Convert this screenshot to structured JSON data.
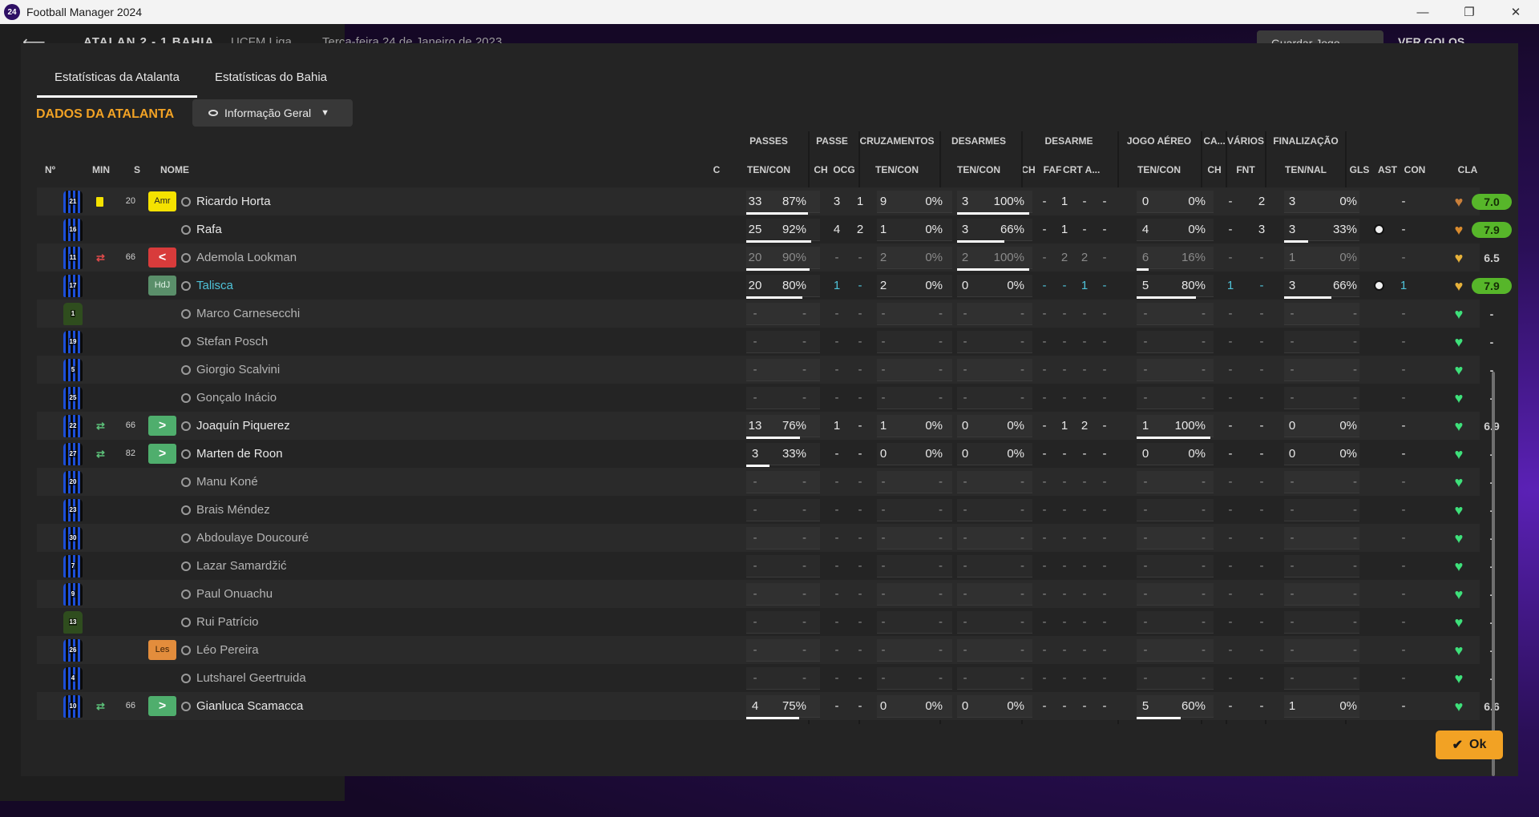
{
  "window": {
    "title": "Football Manager 2024",
    "logo": "24"
  },
  "behind": {
    "score": "ATALAN  2 - 1  BAHIA",
    "competition": "UCFM Liga",
    "date": "Terça-feira 24 de Janeiro de 2023",
    "save_label": "Guardar Jogo",
    "goals_label": "VER GOLOS"
  },
  "tabs": [
    "Estatísticas da Atalanta",
    "Estatísticas do Bahia"
  ],
  "section_title": "DADOS DA ATALANTA",
  "view_select": "Informação Geral",
  "groups": [
    "PASSES",
    "PASSE",
    "CRUZAMENTOS",
    "DESARMES",
    "DESARME",
    "JOGO AÉREO",
    "CA...",
    "VÁRIOS",
    "FINALIZAÇÃO"
  ],
  "columns": {
    "no": "Nº",
    "min": "MIN",
    "s": "S",
    "name": "NOME",
    "c": "C",
    "sub": [
      "TEN/CON",
      "CH",
      "OCG",
      "TEN/CON",
      "TEN/CON",
      "CH",
      "FAF",
      "CRT",
      "A...",
      "TEN/CON",
      "CH",
      "FNT",
      "TEN/NAL",
      "GLS",
      "AST",
      "CON",
      "CLA"
    ]
  },
  "players": [
    {
      "no": "21",
      "gk": false,
      "card": "yellow",
      "sub": "",
      "min": "20",
      "badge": "Amr",
      "badgeType": "amr",
      "name": "Ricardo Horta",
      "state": "active",
      "pass": [
        "33",
        "87%"
      ],
      "passBar": 0.87,
      "ch": "3",
      "ocg": "1",
      "cross": [
        "9",
        "0%"
      ],
      "crossBar": 0,
      "tackle": [
        "3",
        "100%"
      ],
      "tackleBar": 1,
      "d": [
        "-",
        "1",
        "-",
        "-"
      ],
      "air": [
        "0",
        "0%"
      ],
      "airBar": 0,
      "ca": "-",
      "fnt": "2",
      "fin": [
        "3",
        "0%"
      ],
      "finBar": 0,
      "gls": "",
      "ast": "-",
      "con": "#c97f3a",
      "cla": "7.0",
      "claGreen": true
    },
    {
      "no": "16",
      "gk": false,
      "card": "",
      "sub": "",
      "min": "",
      "badge": "",
      "badgeType": "",
      "name": "Rafa",
      "state": "active",
      "pass": [
        "25",
        "92%"
      ],
      "passBar": 0.92,
      "ch": "4",
      "ocg": "2",
      "cross": [
        "1",
        "0%"
      ],
      "crossBar": 0,
      "tackle": [
        "3",
        "66%"
      ],
      "tackleBar": 0.66,
      "d": [
        "-",
        "1",
        "-",
        "-"
      ],
      "air": [
        "4",
        "0%"
      ],
      "airBar": 0,
      "ca": "-",
      "fnt": "3",
      "fin": [
        "3",
        "33%"
      ],
      "finBar": 0.33,
      "gls": "ball",
      "ast": "-",
      "con": "#d98b2e",
      "cla": "7.9",
      "claGreen": true
    },
    {
      "no": "11",
      "gk": false,
      "card": "",
      "sub": "out",
      "min": "66",
      "badge": "<",
      "badgeType": "out",
      "name": "Ademola Lookman",
      "state": "inactive",
      "pass": [
        "20",
        "90%"
      ],
      "passBar": 0.9,
      "ch": "-",
      "ocg": "-",
      "cross": [
        "2",
        "0%"
      ],
      "crossBar": 0,
      "tackle": [
        "2",
        "100%"
      ],
      "tackleBar": 1,
      "d": [
        "-",
        "2",
        "2",
        "-"
      ],
      "air": [
        "6",
        "16%"
      ],
      "airBar": 0.16,
      "ca": "-",
      "fnt": "-",
      "fin": [
        "1",
        "0%"
      ],
      "finBar": 0,
      "gls": "",
      "ast": "-",
      "con": "#e6b13a",
      "cla": "6.5",
      "claGreen": false
    },
    {
      "no": "17",
      "gk": false,
      "card": "",
      "sub": "",
      "min": "",
      "badge": "HdJ",
      "badgeType": "hdj",
      "name": "Talisca",
      "state": "hl",
      "pass": [
        "20",
        "80%"
      ],
      "passBar": 0.8,
      "ch": "1",
      "ocg": "-",
      "cross": [
        "2",
        "0%"
      ],
      "crossBar": 0,
      "tackle": [
        "0",
        "0%"
      ],
      "tackleBar": 0,
      "d": [
        "-",
        "-",
        "1",
        "-"
      ],
      "air": [
        "5",
        "80%"
      ],
      "airBar": 0.8,
      "ca": "1",
      "fnt": "-",
      "fin": [
        "3",
        "66%"
      ],
      "finBar": 0.66,
      "gls": "ball",
      "ast": "1",
      "con": "#e6b13a",
      "cla": "7.9",
      "claGreen": true
    },
    {
      "no": "1",
      "gk": true,
      "card": "",
      "sub": "",
      "min": "",
      "badge": "",
      "badgeType": "",
      "name": "Marco Carnesecchi",
      "state": "inactive",
      "pass": [
        "-",
        "-"
      ],
      "passBar": 0,
      "ch": "-",
      "ocg": "-",
      "cross": [
        "-",
        "-"
      ],
      "crossBar": 0,
      "tackle": [
        "-",
        "-"
      ],
      "tackleBar": 0,
      "d": [
        "-",
        "-",
        "-",
        "-"
      ],
      "air": [
        "-",
        "-"
      ],
      "airBar": 0,
      "ca": "-",
      "fnt": "-",
      "fin": [
        "-",
        "-"
      ],
      "finBar": 0,
      "gls": "",
      "ast": "-",
      "con": "#3ee07a",
      "cla": "-",
      "claGreen": false
    },
    {
      "no": "19",
      "gk": false,
      "card": "",
      "sub": "",
      "min": "",
      "badge": "",
      "badgeType": "",
      "name": "Stefan Posch",
      "state": "inactive",
      "pass": [
        "-",
        "-"
      ],
      "passBar": 0,
      "ch": "-",
      "ocg": "-",
      "cross": [
        "-",
        "-"
      ],
      "crossBar": 0,
      "tackle": [
        "-",
        "-"
      ],
      "tackleBar": 0,
      "d": [
        "-",
        "-",
        "-",
        "-"
      ],
      "air": [
        "-",
        "-"
      ],
      "airBar": 0,
      "ca": "-",
      "fnt": "-",
      "fin": [
        "-",
        "-"
      ],
      "finBar": 0,
      "gls": "",
      "ast": "-",
      "con": "#3ee07a",
      "cla": "-",
      "claGreen": false
    },
    {
      "no": "5",
      "gk": false,
      "card": "",
      "sub": "",
      "min": "",
      "badge": "",
      "badgeType": "",
      "name": "Giorgio Scalvini",
      "state": "inactive",
      "pass": [
        "-",
        "-"
      ],
      "passBar": 0,
      "ch": "-",
      "ocg": "-",
      "cross": [
        "-",
        "-"
      ],
      "crossBar": 0,
      "tackle": [
        "-",
        "-"
      ],
      "tackleBar": 0,
      "d": [
        "-",
        "-",
        "-",
        "-"
      ],
      "air": [
        "-",
        "-"
      ],
      "airBar": 0,
      "ca": "-",
      "fnt": "-",
      "fin": [
        "-",
        "-"
      ],
      "finBar": 0,
      "gls": "",
      "ast": "-",
      "con": "#3ee07a",
      "cla": "-",
      "claGreen": false
    },
    {
      "no": "25",
      "gk": false,
      "card": "",
      "sub": "",
      "min": "",
      "badge": "",
      "badgeType": "",
      "name": "Gonçalo Inácio",
      "state": "inactive",
      "pass": [
        "-",
        "-"
      ],
      "passBar": 0,
      "ch": "-",
      "ocg": "-",
      "cross": [
        "-",
        "-"
      ],
      "crossBar": 0,
      "tackle": [
        "-",
        "-"
      ],
      "tackleBar": 0,
      "d": [
        "-",
        "-",
        "-",
        "-"
      ],
      "air": [
        "-",
        "-"
      ],
      "airBar": 0,
      "ca": "-",
      "fnt": "-",
      "fin": [
        "-",
        "-"
      ],
      "finBar": 0,
      "gls": "",
      "ast": "-",
      "con": "#3ee07a",
      "cla": "-",
      "claGreen": false
    },
    {
      "no": "22",
      "gk": false,
      "card": "",
      "sub": "in",
      "min": "66",
      "badge": ">",
      "badgeType": "in",
      "name": "Joaquín Piquerez",
      "state": "active",
      "pass": [
        "13",
        "76%"
      ],
      "passBar": 0.76,
      "ch": "1",
      "ocg": "-",
      "cross": [
        "1",
        "0%"
      ],
      "crossBar": 0,
      "tackle": [
        "0",
        "0%"
      ],
      "tackleBar": 0,
      "d": [
        "-",
        "1",
        "2",
        "-"
      ],
      "air": [
        "1",
        "100%"
      ],
      "airBar": 1,
      "ca": "-",
      "fnt": "-",
      "fin": [
        "0",
        "0%"
      ],
      "finBar": 0,
      "gls": "",
      "ast": "-",
      "con": "#3ee07a",
      "cla": "6.9",
      "claGreen": false
    },
    {
      "no": "27",
      "gk": false,
      "card": "",
      "sub": "in",
      "min": "82",
      "badge": ">",
      "badgeType": "in",
      "name": "Marten de Roon",
      "state": "active",
      "pass": [
        "3",
        "33%"
      ],
      "passBar": 0.33,
      "ch": "-",
      "ocg": "-",
      "cross": [
        "0",
        "0%"
      ],
      "crossBar": 0,
      "tackle": [
        "0",
        "0%"
      ],
      "tackleBar": 0,
      "d": [
        "-",
        "-",
        "-",
        "-"
      ],
      "air": [
        "0",
        "0%"
      ],
      "airBar": 0,
      "ca": "-",
      "fnt": "-",
      "fin": [
        "0",
        "0%"
      ],
      "finBar": 0,
      "gls": "",
      "ast": "-",
      "con": "#3ee07a",
      "cla": "-",
      "claGreen": false
    },
    {
      "no": "20",
      "gk": false,
      "card": "",
      "sub": "",
      "min": "",
      "badge": "",
      "badgeType": "",
      "name": "Manu Koné",
      "state": "inactive",
      "pass": [
        "-",
        "-"
      ],
      "passBar": 0,
      "ch": "-",
      "ocg": "-",
      "cross": [
        "-",
        "-"
      ],
      "crossBar": 0,
      "tackle": [
        "-",
        "-"
      ],
      "tackleBar": 0,
      "d": [
        "-",
        "-",
        "-",
        "-"
      ],
      "air": [
        "-",
        "-"
      ],
      "airBar": 0,
      "ca": "-",
      "fnt": "-",
      "fin": [
        "-",
        "-"
      ],
      "finBar": 0,
      "gls": "",
      "ast": "-",
      "con": "#3ee07a",
      "cla": "-",
      "claGreen": false
    },
    {
      "no": "23",
      "gk": false,
      "card": "",
      "sub": "",
      "min": "",
      "badge": "",
      "badgeType": "",
      "name": "Brais Méndez",
      "state": "inactive",
      "pass": [
        "-",
        "-"
      ],
      "passBar": 0,
      "ch": "-",
      "ocg": "-",
      "cross": [
        "-",
        "-"
      ],
      "crossBar": 0,
      "tackle": [
        "-",
        "-"
      ],
      "tackleBar": 0,
      "d": [
        "-",
        "-",
        "-",
        "-"
      ],
      "air": [
        "-",
        "-"
      ],
      "airBar": 0,
      "ca": "-",
      "fnt": "-",
      "fin": [
        "-",
        "-"
      ],
      "finBar": 0,
      "gls": "",
      "ast": "-",
      "con": "#3ee07a",
      "cla": "-",
      "claGreen": false
    },
    {
      "no": "30",
      "gk": false,
      "card": "",
      "sub": "",
      "min": "",
      "badge": "",
      "badgeType": "",
      "name": "Abdoulaye Doucouré",
      "state": "inactive",
      "pass": [
        "-",
        "-"
      ],
      "passBar": 0,
      "ch": "-",
      "ocg": "-",
      "cross": [
        "-",
        "-"
      ],
      "crossBar": 0,
      "tackle": [
        "-",
        "-"
      ],
      "tackleBar": 0,
      "d": [
        "-",
        "-",
        "-",
        "-"
      ],
      "air": [
        "-",
        "-"
      ],
      "airBar": 0,
      "ca": "-",
      "fnt": "-",
      "fin": [
        "-",
        "-"
      ],
      "finBar": 0,
      "gls": "",
      "ast": "-",
      "con": "#3ee07a",
      "cla": "-",
      "claGreen": false
    },
    {
      "no": "7",
      "gk": false,
      "card": "",
      "sub": "",
      "min": "",
      "badge": "",
      "badgeType": "",
      "name": "Lazar Samardžić",
      "state": "inactive",
      "pass": [
        "-",
        "-"
      ],
      "passBar": 0,
      "ch": "-",
      "ocg": "-",
      "cross": [
        "-",
        "-"
      ],
      "crossBar": 0,
      "tackle": [
        "-",
        "-"
      ],
      "tackleBar": 0,
      "d": [
        "-",
        "-",
        "-",
        "-"
      ],
      "air": [
        "-",
        "-"
      ],
      "airBar": 0,
      "ca": "-",
      "fnt": "-",
      "fin": [
        "-",
        "-"
      ],
      "finBar": 0,
      "gls": "",
      "ast": "-",
      "con": "#3ee07a",
      "cla": "-",
      "claGreen": false
    },
    {
      "no": "9",
      "gk": false,
      "card": "",
      "sub": "",
      "min": "",
      "badge": "",
      "badgeType": "",
      "name": "Paul Onuachu",
      "state": "inactive",
      "pass": [
        "-",
        "-"
      ],
      "passBar": 0,
      "ch": "-",
      "ocg": "-",
      "cross": [
        "-",
        "-"
      ],
      "crossBar": 0,
      "tackle": [
        "-",
        "-"
      ],
      "tackleBar": 0,
      "d": [
        "-",
        "-",
        "-",
        "-"
      ],
      "air": [
        "-",
        "-"
      ],
      "airBar": 0,
      "ca": "-",
      "fnt": "-",
      "fin": [
        "-",
        "-"
      ],
      "finBar": 0,
      "gls": "",
      "ast": "-",
      "con": "#3ee07a",
      "cla": "-",
      "claGreen": false
    },
    {
      "no": "13",
      "gk": true,
      "card": "",
      "sub": "",
      "min": "",
      "badge": "",
      "badgeType": "",
      "name": "Rui Patrício",
      "state": "inactive",
      "pass": [
        "-",
        "-"
      ],
      "passBar": 0,
      "ch": "-",
      "ocg": "-",
      "cross": [
        "-",
        "-"
      ],
      "crossBar": 0,
      "tackle": [
        "-",
        "-"
      ],
      "tackleBar": 0,
      "d": [
        "-",
        "-",
        "-",
        "-"
      ],
      "air": [
        "-",
        "-"
      ],
      "airBar": 0,
      "ca": "-",
      "fnt": "-",
      "fin": [
        "-",
        "-"
      ],
      "finBar": 0,
      "gls": "",
      "ast": "-",
      "con": "#3ee07a",
      "cla": "-",
      "claGreen": false
    },
    {
      "no": "26",
      "gk": false,
      "card": "",
      "sub": "",
      "min": "",
      "badge": "Les",
      "badgeType": "les",
      "name": "Léo Pereira",
      "state": "inactive",
      "pass": [
        "-",
        "-"
      ],
      "passBar": 0,
      "ch": "-",
      "ocg": "-",
      "cross": [
        "-",
        "-"
      ],
      "crossBar": 0,
      "tackle": [
        "-",
        "-"
      ],
      "tackleBar": 0,
      "d": [
        "-",
        "-",
        "-",
        "-"
      ],
      "air": [
        "-",
        "-"
      ],
      "airBar": 0,
      "ca": "-",
      "fnt": "-",
      "fin": [
        "-",
        "-"
      ],
      "finBar": 0,
      "gls": "",
      "ast": "-",
      "con": "#3ee07a",
      "cla": "-",
      "claGreen": false
    },
    {
      "no": "4",
      "gk": false,
      "card": "",
      "sub": "",
      "min": "",
      "badge": "",
      "badgeType": "",
      "name": "Lutsharel Geertruida",
      "state": "inactive",
      "pass": [
        "-",
        "-"
      ],
      "passBar": 0,
      "ch": "-",
      "ocg": "-",
      "cross": [
        "-",
        "-"
      ],
      "crossBar": 0,
      "tackle": [
        "-",
        "-"
      ],
      "tackleBar": 0,
      "d": [
        "-",
        "-",
        "-",
        "-"
      ],
      "air": [
        "-",
        "-"
      ],
      "airBar": 0,
      "ca": "-",
      "fnt": "-",
      "fin": [
        "-",
        "-"
      ],
      "finBar": 0,
      "gls": "",
      "ast": "-",
      "con": "#3ee07a",
      "cla": "-",
      "claGreen": false
    },
    {
      "no": "10",
      "gk": false,
      "card": "",
      "sub": "in",
      "min": "66",
      "badge": ">",
      "badgeType": "in",
      "name": "Gianluca Scamacca",
      "state": "active",
      "pass": [
        "4",
        "75%"
      ],
      "passBar": 0.75,
      "ch": "-",
      "ocg": "-",
      "cross": [
        "0",
        "0%"
      ],
      "crossBar": 0,
      "tackle": [
        "0",
        "0%"
      ],
      "tackleBar": 0,
      "d": [
        "-",
        "-",
        "-",
        "-"
      ],
      "air": [
        "5",
        "60%"
      ],
      "airBar": 0.6,
      "ca": "-",
      "fnt": "-",
      "fin": [
        "1",
        "0%"
      ],
      "finBar": 0,
      "gls": "",
      "ast": "-",
      "con": "#3ee07a",
      "cla": "6.6",
      "claGreen": false
    }
  ],
  "ok_label": "Ok"
}
